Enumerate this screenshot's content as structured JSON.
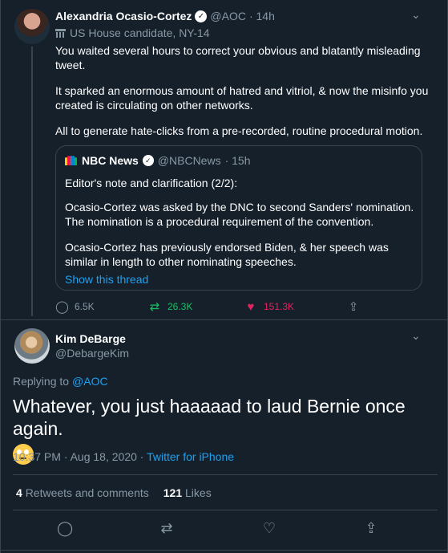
{
  "tweet1": {
    "name": "Alexandria Ocasio-Cortez",
    "handle": "@AOC",
    "time": "· 14h",
    "label": "US House candidate, NY-14",
    "paragraphs": [
      "You waited several hours to correct your obvious and blatantly misleading tweet.",
      "It sparked an enormous amount of hatred and vitriol, & now the misinfo you created is circulating on other networks.",
      "All to generate hate-clicks from a pre-recorded, routine procedural motion."
    ],
    "quote": {
      "name": "NBC News",
      "handle": "@NBCNews",
      "time": "· 15h",
      "paragraphs": [
        "Editor's note and clarification (2/2):",
        "Ocasio-Cortez was asked by the DNC to second Sanders' nomination. The nomination is a procedural requirement of the convention.",
        "Ocasio-Cortez has previously endorsed Biden, & her speech was similar in length to other nominating speeches."
      ],
      "show_thread": "Show this thread"
    },
    "replies": "6.5K",
    "retweets": "26.3K",
    "likes": "151.3K",
    "colors": {
      "retweet": "#17bf63",
      "like": "#e0245e"
    }
  },
  "tweet2": {
    "name": "Kim DeBarge",
    "handle": "@DebargeKim",
    "replying_prefix": "Replying to",
    "replying_to": "@AOC",
    "text": "Whatever, you just haaaaad to laud Bernie once again.",
    "emoji": "rolling-eyes",
    "timestamp": "10:37 PM · Aug 18, 2020 ·",
    "source": "Twitter for iPhone",
    "retweets_count": "4",
    "retweets_label": "Retweets and comments",
    "likes_count": "121",
    "likes_label": "Likes"
  },
  "colors": {
    "background": "#15202b",
    "muted": "#8899a6",
    "link": "#1da1f2",
    "border": "#38444d"
  }
}
